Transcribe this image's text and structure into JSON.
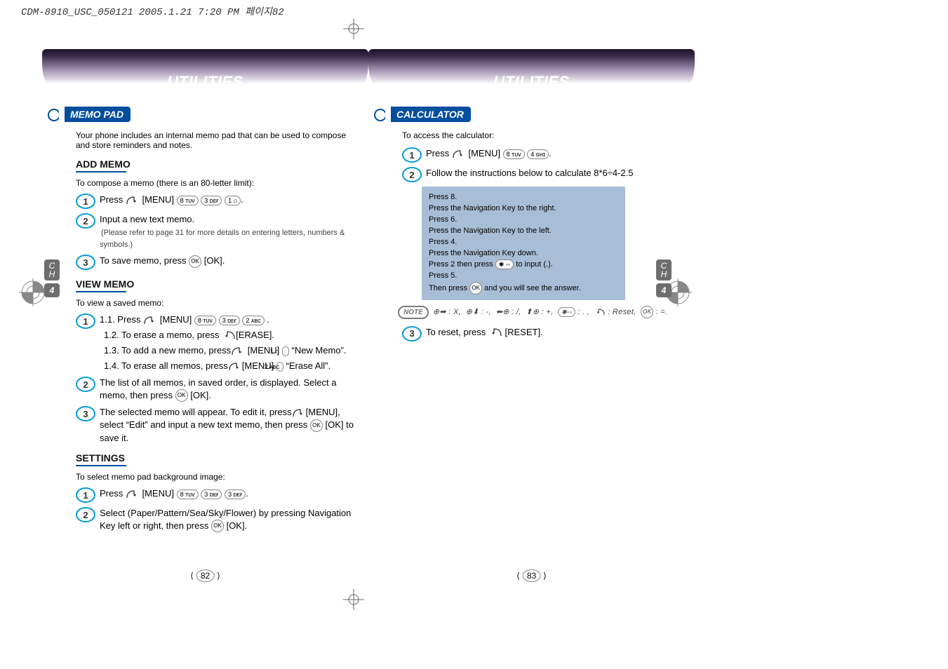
{
  "meta": {
    "headerline": "CDM-8910_USC_050121  2005.1.21 7:20 PM  페이지82"
  },
  "sidetab": {
    "ch": "C\nH",
    "num": "4"
  },
  "left": {
    "title": "UTILITIES",
    "section_tag": "MEMO PAD",
    "intro": "Your phone includes an internal memo pad that can be used to compose and store reminders and notes.",
    "add": {
      "h": "ADD MEMO",
      "intro": "To compose a memo (there is an 80-letter limit):",
      "s1": "Press        [MENU]              .",
      "s2": "Input a new text memo.",
      "s2_sub": "(Please refer to page 31 for more details on entering letters, numbers & symbols.)",
      "s3": "To save memo, press        [OK]."
    },
    "view": {
      "h": "VIEW MEMO",
      "intro": "To view a saved memo:",
      "s1a": "1.1. Press        [MENU]                    .",
      "s1b": "1.2. To erase a memo, press       [ERASE].",
      "s1c": "1.3. To add a new memo, press       [MENU]         “New Memo”.",
      "s1d": "1.4. To erase all memos, press       [MENU]         “Erase All”.",
      "s2": "The list of all memos, in saved order, is displayed. Select a memo, then press        [OK].",
      "s3": "The selected memo will appear. To edit it, press       [MENU], select “Edit” and input a new text memo, then press        [OK] to save it."
    },
    "settings": {
      "h": "SETTINGS",
      "intro": "To select memo pad background image:",
      "s1": "Press        [MENU]                    .",
      "s2": "Select (Paper/Pattern/Sea/Sky/Flower) by pressing Navigation Key left or right, then press        [OK]."
    },
    "pagenum": "82"
  },
  "right": {
    "title": "UTILITIES",
    "section_tag": "CALCULATOR",
    "intro": "To access the calculator:",
    "s1": "Press        [MENU]              .",
    "s2": "Follow the instructions below to calculate 8*6÷4-2.5",
    "calcbox": [
      "Press 8.",
      "Press the Navigation Key to the right.",
      "Press 6.",
      "Press the Navigation Key to the left.",
      "Press 4.",
      "Press the Navigation Key down.",
      "Press 2 then press        to input (.).",
      "Press 5.",
      "Then press        and you will see the answer."
    ],
    "note": "NOTE",
    "note_text": "      : X,       : -,      : /,       : +,       : . ,       : Reset,        : =.",
    "s3": "To reset, press        [RESET].",
    "pagenum": "83"
  }
}
